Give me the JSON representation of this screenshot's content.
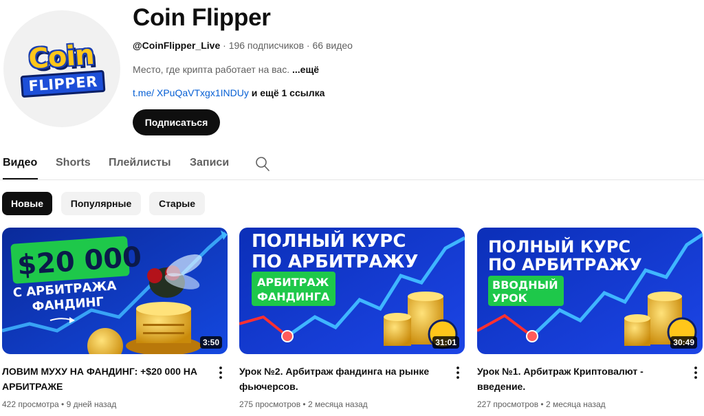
{
  "channel": {
    "avatar_logo_top": "Coin",
    "avatar_logo_bottom": "FLIPPER",
    "title": "Coin Flipper",
    "handle": "@CoinFlipper_Live",
    "subscribers": "196 подписчиков",
    "video_count": "66 видео",
    "meta_separator": " · ",
    "description": "Место, где крипта работает на вас. ",
    "description_more": "...ещё",
    "link": "t.me/ XPuQaVTxgx1INDUy",
    "link_more": " и ещё 1 ссылка",
    "subscribe_label": "Подписаться"
  },
  "tabs": [
    {
      "label": "Видео",
      "active": true
    },
    {
      "label": "Shorts",
      "active": false
    },
    {
      "label": "Плейлисты",
      "active": false
    },
    {
      "label": "Записи",
      "active": false
    }
  ],
  "chips": [
    {
      "label": "Новые",
      "active": true
    },
    {
      "label": "Популярные",
      "active": false
    },
    {
      "label": "Старые",
      "active": false
    }
  ],
  "videos": [
    {
      "thumb_line1": "$20 000",
      "thumb_line2": "С АРБИТРАЖА",
      "thumb_line3": "ФАНДИНГ",
      "duration": "3:50",
      "title": "ЛОВИМ МУХУ НА ФАНДИНГ: +$20 000 НА АРБИТРАЖЕ",
      "views": "422 просмотра",
      "age": "9 дней назад"
    },
    {
      "thumb_line1": "ПОЛНЫЙ КУРС",
      "thumb_line2": "ПО АРБИТРАЖУ",
      "thumb_badge1": "АРБИТРАЖ",
      "thumb_badge2": "ФАНДИНГА",
      "duration": "31:01",
      "title": "Урок №2. Арбитраж фандинга на рынке фьючерсов.",
      "views": "275 просмотров",
      "age": "2 месяца назад"
    },
    {
      "thumb_line1": "ПОЛНЫЙ КУРС",
      "thumb_line2": "ПО АРБИТРАЖУ",
      "thumb_badge1": "ВВОДНЫЙ",
      "thumb_badge2": "УРОК",
      "duration": "30:49",
      "title": "Урок №1. Арбитраж Криптовалют - введение.",
      "views": "227 просмотров",
      "age": "2 месяца назад"
    }
  ],
  "meta_dot": " • ",
  "icons": {
    "search": "search-icon",
    "more": "more-vertical-icon"
  },
  "colors": {
    "accent_link": "#065fd4",
    "chip_active": "#0f0f0f",
    "badge_green": "#1ec84a",
    "thumb_blue": "#1a3ad6"
  }
}
